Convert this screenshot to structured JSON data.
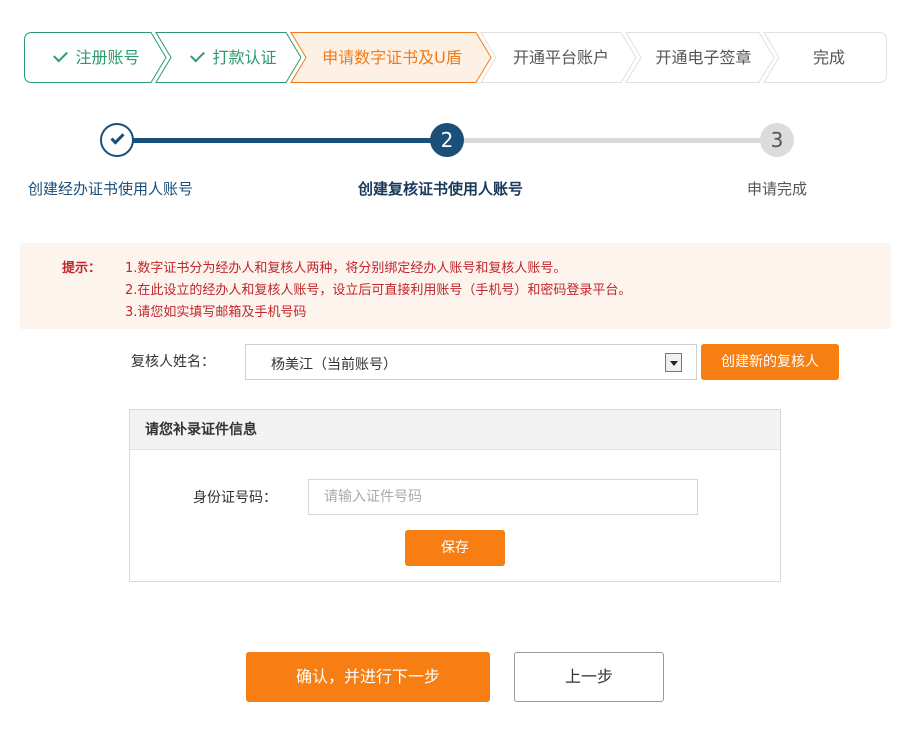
{
  "steps": [
    {
      "label": "注册账号",
      "state": "done"
    },
    {
      "label": "打款认证",
      "state": "done"
    },
    {
      "label": "申请数字证书及U盾",
      "state": "active"
    },
    {
      "label": "开通平台账户",
      "state": "todo"
    },
    {
      "label": "开通电子签章",
      "state": "todo"
    },
    {
      "label": "完成",
      "state": "todo"
    }
  ],
  "progress": {
    "nodes": [
      {
        "number": "",
        "label": "创建经办证书使用人账号",
        "state": "done"
      },
      {
        "number": "2",
        "label": "创建复核证书使用人账号",
        "state": "active"
      },
      {
        "number": "3",
        "label": "申请完成",
        "state": "todo"
      }
    ]
  },
  "tip": {
    "label": "提示：",
    "lines": [
      "1.数字证书分为经办人和复核人两种，将分别绑定经办人账号和复核人账号。",
      "2.在此设立的经办人和复核人账号，设立后可直接利用账号（手机号）和密码登录平台。",
      "3.请您如实填写邮箱及手机号码"
    ]
  },
  "reviewer": {
    "label": "复核人姓名：",
    "selected": "杨美江（当前账号）",
    "create_button": "创建新的复核人"
  },
  "cert_panel": {
    "title": "请您补录证件信息",
    "id_label": "身份证号码：",
    "id_placeholder": "请输入证件号码",
    "save_button": "保存"
  },
  "actions": {
    "confirm": "确认，并进行下一步",
    "prev": "上一步"
  },
  "colors": {
    "done_green": "#2b9a6e",
    "active_orange": "#f27a1a",
    "progress_blue": "#1a4f7a",
    "button_orange": "#f77e12",
    "tip_red": "#c0262b"
  }
}
